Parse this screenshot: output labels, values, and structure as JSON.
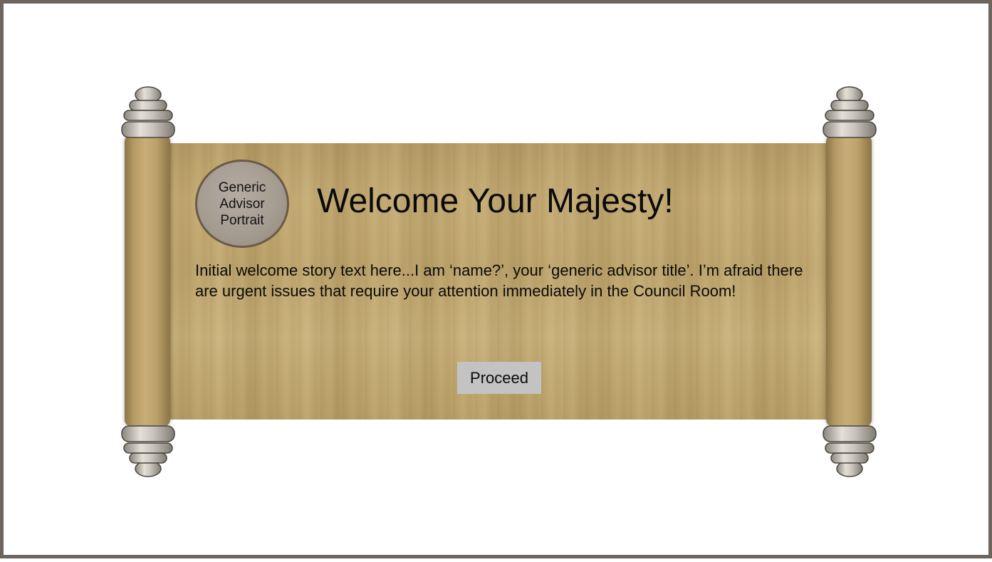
{
  "dialog": {
    "portrait_label": "Generic Advisor Portrait",
    "title": "Welcome Your Majesty!",
    "story": "Initial welcome story text here...I am ‘name?’, your ‘generic advisor title’. I’m afraid there are urgent issues that require your attention immediately in the Council Room!",
    "proceed_label": "Proceed"
  },
  "colors": {
    "frame_border": "#6e665e",
    "parchment": "#c2a870",
    "button": "#c3c3c3"
  },
  "icons": {
    "scroll_cap": "scroll-end-cap-icon"
  }
}
